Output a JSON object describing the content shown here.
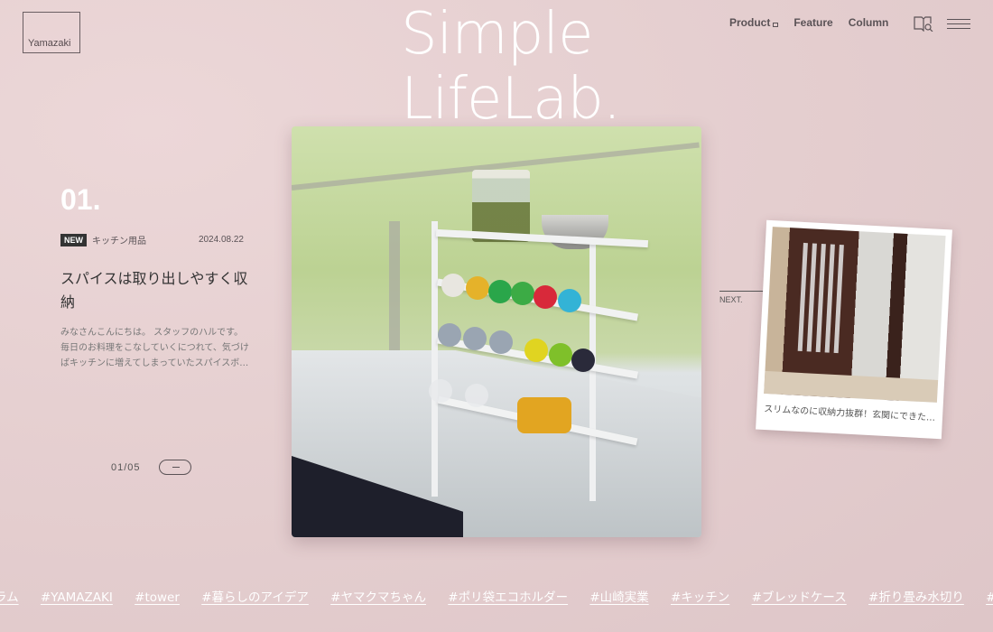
{
  "brand": {
    "logo_text": "Yamazaki",
    "site_title_line1": "Simple",
    "site_title_line2": "LifeLab."
  },
  "nav": {
    "items": [
      {
        "label": "Product",
        "external": true
      },
      {
        "label": "Feature",
        "external": false
      },
      {
        "label": "Column",
        "external": false
      }
    ],
    "icons": [
      "book-search-icon",
      "hamburger-menu-icon"
    ]
  },
  "article": {
    "number": "01.",
    "badge": "NEW",
    "category": "キッチン用品",
    "date": "2024.08.22",
    "title": "スパイスは取り出しやすく収納",
    "excerpt": "みなさんこんにちは。 スタッフのハルです。毎日のお料理をこなしていくにつれて、気づけばキッチンに増えてしまっていたスパイスボ…",
    "image_alt": "spice-rack-photo"
  },
  "pager": {
    "current": "01",
    "total": "05",
    "text": "01/05",
    "next_icon": "arrow-right-icon"
  },
  "next_card": {
    "label": "NEXT.",
    "caption": "スリムなのに収納力抜群！玄関にできた…",
    "image_alt": "entryway-coat-stand-photo"
  },
  "tags": [
    "ラム",
    "#YAMAZAKI",
    "#tower",
    "#暮らしのアイデア",
    "#ヤマクマちゃん",
    "#ポリ袋エコホルダー",
    "#山崎実業",
    "#キッチン",
    "#ブレッドケース",
    "#折り畳み水切り",
    "#スタッフ"
  ],
  "colors": {
    "background": "#e6d0d1",
    "text_dark": "#333333",
    "badge_bg": "#333333",
    "accent_white": "#ffffff"
  }
}
